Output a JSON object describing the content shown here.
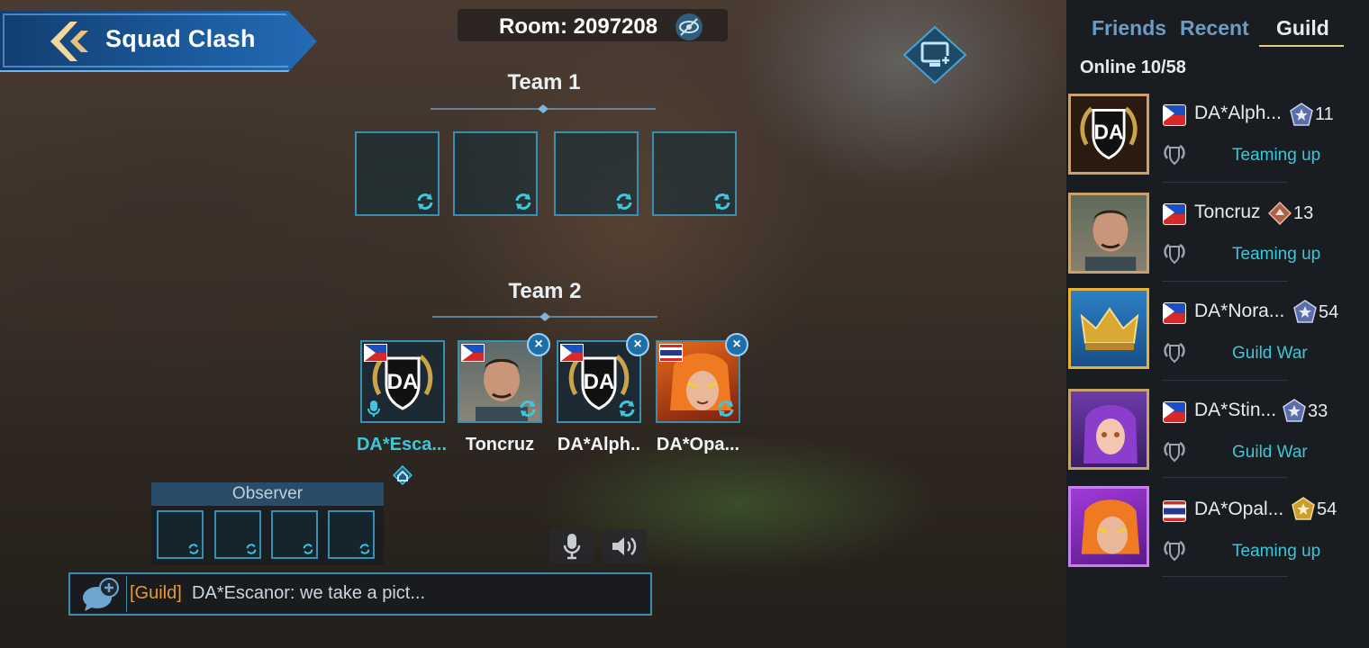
{
  "header": {
    "title": "Squad Clash",
    "room_label": "Room: 2097208"
  },
  "teams": {
    "team1_label": "Team 1",
    "team2_label": "Team 2",
    "team2_players": [
      {
        "name": "DA*Esca...",
        "flag": "ph",
        "highlight": true
      },
      {
        "name": "Toncruz",
        "flag": "ph"
      },
      {
        "name": "DA*Alph..",
        "flag": "ph"
      },
      {
        "name": "DA*Opa...",
        "flag": "th"
      }
    ]
  },
  "observer": {
    "label": "Observer"
  },
  "chat": {
    "channel": "[Guild]",
    "message": "DA*Escanor: we take a pict..."
  },
  "sidebar": {
    "tabs": [
      "Friends",
      "Recent",
      "Guild"
    ],
    "active_tab": "Guild",
    "online": "Online 10/58",
    "members": [
      {
        "name": "DA*Alph...",
        "rank": "11",
        "status": "Teaming up",
        "flag": "ph"
      },
      {
        "name": "Toncruz",
        "rank": "13",
        "status": "Teaming up",
        "flag": "ph"
      },
      {
        "name": "DA*Nora...",
        "rank": "54",
        "status": "Guild War",
        "flag": "ph"
      },
      {
        "name": "DA*Stin...",
        "rank": "33",
        "status": "Guild War",
        "flag": "ph"
      },
      {
        "name": "DA*Opal...",
        "rank": "54",
        "status": "Teaming up",
        "flag": "th"
      }
    ]
  },
  "colors": {
    "accent": "#3a8fb0",
    "status": "#39c8d8",
    "guild_tag": "#e39a3a",
    "highlight_name": "#39c8d8"
  }
}
